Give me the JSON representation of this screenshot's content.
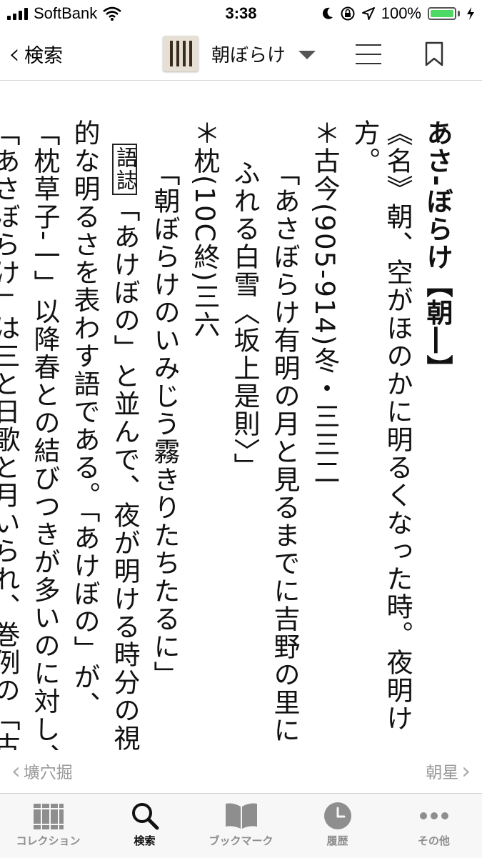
{
  "status_bar": {
    "carrier": "SoftBank",
    "time": "3:38",
    "battery": "100%"
  },
  "nav": {
    "back_label": "検索",
    "title": "朝ぼらけ"
  },
  "entry": {
    "columns": [
      "あさ-ぼらけ【朝―】",
      "《名》朝、空がほのかに明るくなった時。夜明け",
      "方。",
      "＊古今(905-914)冬・三三二",
      "「あさぼらけ有明の月と見るまでに吉野の里に",
      "ふれる白雪〈坂上是則〉」",
      "＊枕(10C終)三六",
      "「朝ぼらけのいみじう霧きりたちたるに」",
      "",
      "「あけぼの」と並んで、夜が明ける時分の視覚",
      "的な明るさを表わす語である。「あけぼの」が、",
      "「枕草子-一」以降春との結びつきが多いのに対し、",
      "「あさぼらけ」は三と日歌と月いられ、巻例の「古"
    ],
    "marker_label": "語誌"
  },
  "pager": {
    "prev": "壙穴掘",
    "next": "朝星"
  },
  "tabs": [
    {
      "label": "コレクション"
    },
    {
      "label": "検索"
    },
    {
      "label": "ブックマーク"
    },
    {
      "label": "履歴"
    },
    {
      "label": "その他"
    }
  ],
  "colors": {
    "battery": "#4cd964",
    "active_tab": "#111111",
    "inactive_tab": "#8e8e8e"
  }
}
